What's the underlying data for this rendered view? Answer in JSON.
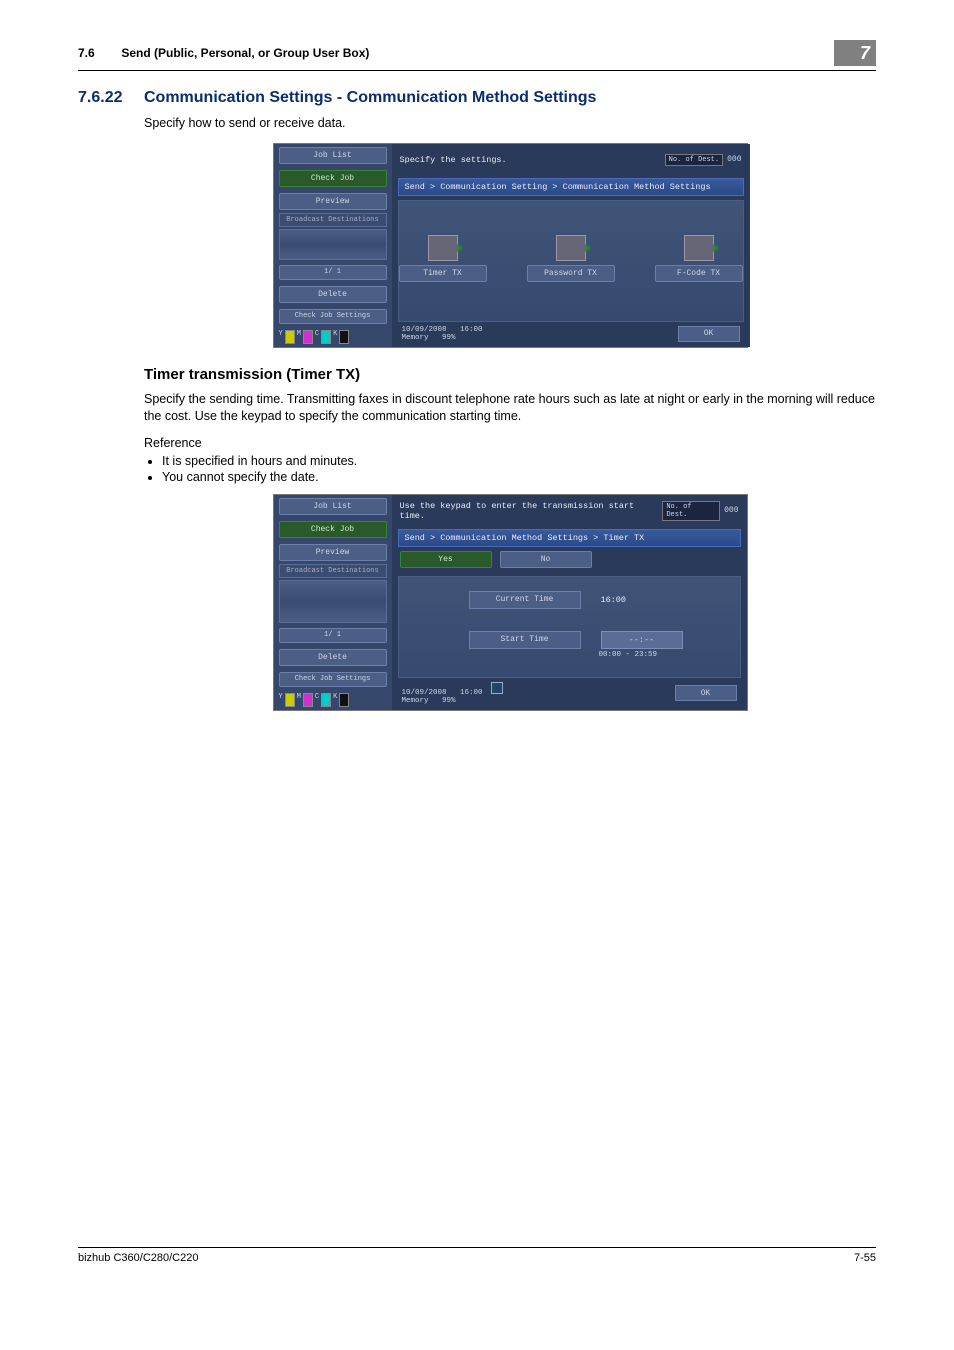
{
  "header": {
    "section_number": "7.6",
    "section_title": "Send (Public, Personal, or Group User Box)",
    "chapter_number": "7"
  },
  "section": {
    "number": "7.6.22",
    "title": "Communication Settings - Communication Method Settings",
    "intro": "Specify how to send or receive data."
  },
  "screenshot1": {
    "left": {
      "job_list": "Job List",
      "check_job": "Check Job",
      "preview": "Preview",
      "broadcast": "Broadcast Destinations",
      "pager": "1/ 1",
      "delete": "Delete",
      "check_settings": "Check Job Settings"
    },
    "msg": "Specify the settings.",
    "counter_label": "No. of Dest.",
    "counter_value": "000",
    "breadcrumb": "Send > Communication Setting  > Communication Method Settings",
    "options": {
      "timer": "Timer TX",
      "password": "Password TX",
      "fcode": "F-Code TX"
    },
    "status": {
      "date": "10/09/2008",
      "time": "16:00",
      "mem_label": "Memory",
      "mem_value": "99%"
    },
    "ok": "OK"
  },
  "sub": {
    "title": "Timer transmission (Timer TX)",
    "para": "Specify the sending time. Transmitting faxes in discount telephone rate hours such as late at night or early in the morning will reduce the cost. Use the keypad to specify the communication starting time.",
    "reference": "Reference",
    "bullets": [
      "It is specified in hours and minutes.",
      "You cannot specify the date."
    ]
  },
  "screenshot2": {
    "left": {
      "job_list": "Job List",
      "check_job": "Check Job",
      "preview": "Preview",
      "broadcast": "Broadcast Destinations",
      "pager": "1/ 1",
      "delete": "Delete",
      "check_settings": "Check Job Settings"
    },
    "msg": "Use the keypad to enter the transmission start time.",
    "counter_label": "No. of Dest.",
    "counter_value": "000",
    "breadcrumb": "Send > Communication Method Settings > Timer TX",
    "yes": "Yes",
    "no": "No",
    "current_time_label": "Current Time",
    "current_time_value": "16:00",
    "start_time_label": "Start Time",
    "start_time_value": "--:--",
    "range": "00:00  -  23:59",
    "status": {
      "date": "10/09/2008",
      "time": "16:00",
      "mem_label": "Memory",
      "mem_value": "99%"
    },
    "ok": "OK"
  },
  "footer": {
    "left": "bizhub C360/C280/C220",
    "right": "7-55"
  }
}
